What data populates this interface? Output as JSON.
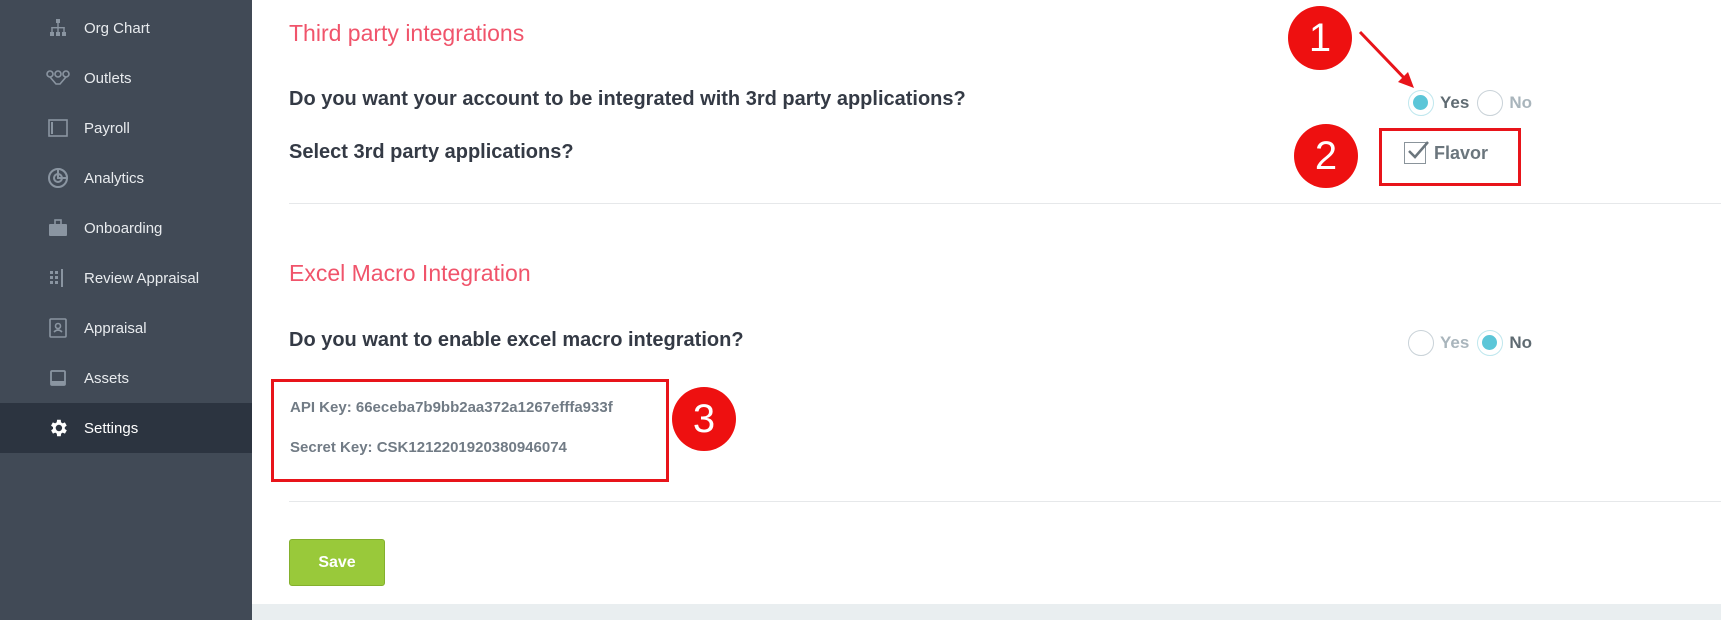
{
  "sidebar": {
    "items": [
      {
        "label": "Org Chart",
        "icon": "org-chart-icon"
      },
      {
        "label": "Outlets",
        "icon": "outlets-icon"
      },
      {
        "label": "Payroll",
        "icon": "payroll-icon"
      },
      {
        "label": "Analytics",
        "icon": "analytics-icon"
      },
      {
        "label": "Onboarding",
        "icon": "briefcase-icon"
      },
      {
        "label": "Review Appraisal",
        "icon": "review-appraisal-icon"
      },
      {
        "label": "Appraisal",
        "icon": "appraisal-icon"
      },
      {
        "label": "Assets",
        "icon": "assets-icon"
      },
      {
        "label": "Settings",
        "icon": "gear-icon",
        "active": true
      }
    ]
  },
  "third_party": {
    "title": "Third party integrations",
    "question": "Do you want your account to be integrated with 3rd party applications?",
    "options": {
      "yes": "Yes",
      "no": "No",
      "selected": "Yes"
    },
    "select_question": "Select 3rd party applications?",
    "app_checkbox": {
      "label": "Flavor",
      "checked": true
    }
  },
  "excel_macro": {
    "title": "Excel Macro Integration",
    "question": "Do you want to enable excel macro integration?",
    "options": {
      "yes": "Yes",
      "no": "No",
      "selected": "No"
    },
    "api_key": "API Key: 66eceba7b9bb2aa372a1267efffa933f",
    "secret_key": "Secret Key: CSK1212201920380946074"
  },
  "save_label": "Save",
  "annotations": {
    "badge_1": "1",
    "badge_2": "2",
    "badge_3": "3",
    "color": "#e8141a"
  },
  "colors": {
    "sidebar_bg": "#414a56",
    "sidebar_active": "#2c3440",
    "section_title": "#f0546b",
    "radio_accent": "#5cc6d8",
    "save_button": "#99c93a"
  }
}
